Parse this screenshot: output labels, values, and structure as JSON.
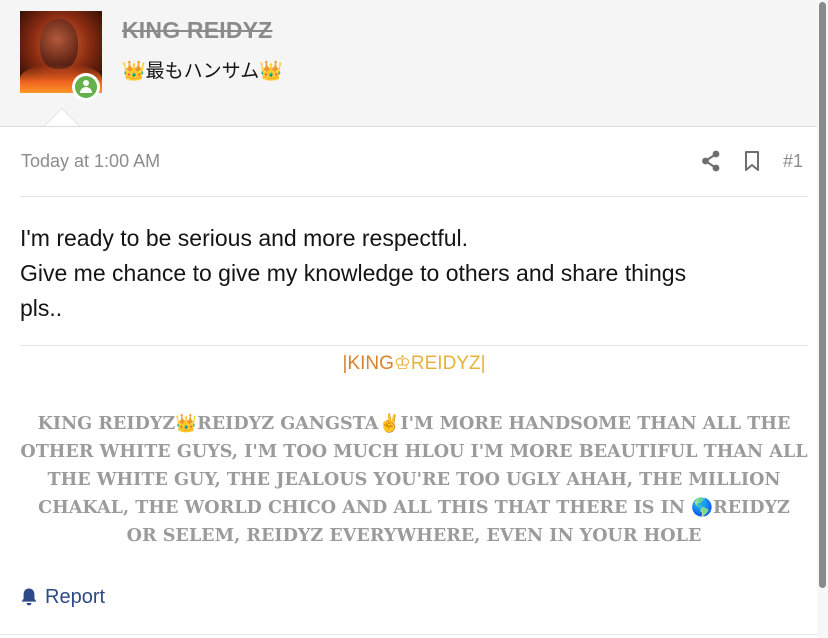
{
  "user": {
    "name": "KING REIDYZ",
    "title": "👑最もハンサム👑"
  },
  "post": {
    "timestamp": "Today at 1:00 AM",
    "number": "#1",
    "body_lines": [
      "I'm ready to be serious and more respectful.",
      "Give me chance to give my knowledge to others and share things",
      "pls.."
    ]
  },
  "signature": {
    "name_prefix": "|KING",
    "name_crown": "♔",
    "name_suffix": "REIDYZ|",
    "lines": [
      "KING REIDYZ👑REIDYZ GANGSTA✌️I'M MORE HANDSOME THAN ALL THE",
      "OTHER WHITE GUYS, I'M TOO MUCH HLOU I'M MORE BEAUTIFUL THAN ALL",
      "THE WHITE GUY, THE JEALOUS YOU'RE TOO UGLY AHAH, THE MILLION",
      "CHAKAL, THE WORLD CHICO AND ALL THIS THAT THERE IS IN 🌎REIDYZ",
      "OR SELEM, REIDYZ EVERYWHERE, EVEN IN YOUR HOLE"
    ]
  },
  "actions": {
    "report_label": "Report"
  },
  "icons": {
    "share": "share-icon",
    "bookmark": "bookmark-icon",
    "report": "bell-icon",
    "online": "user-online-icon"
  },
  "colors": {
    "link": "#2e4a86",
    "muted": "#8c8c8c",
    "online": "#63b14a",
    "signature_orange": "#d9822b",
    "signature_gold": "#e8b13a"
  }
}
